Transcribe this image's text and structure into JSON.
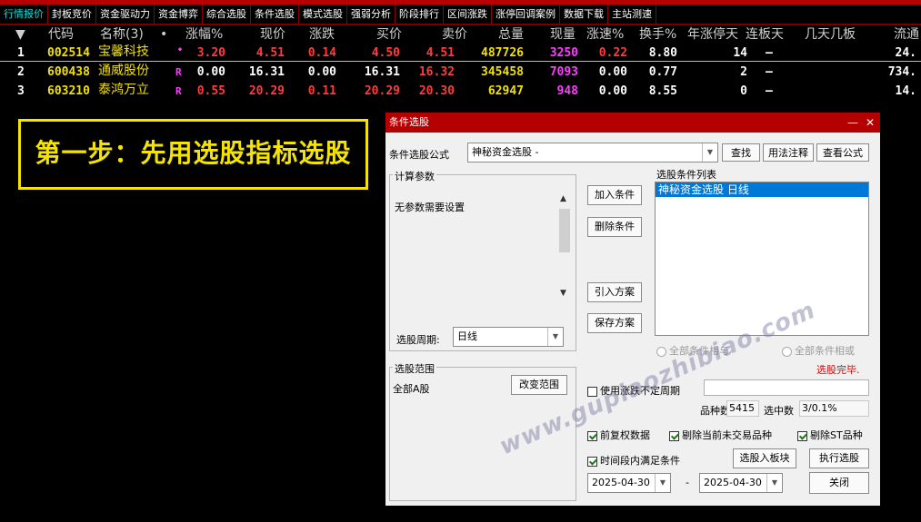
{
  "tabs": [
    "行情报价",
    "封板竞价",
    "资金驱动力",
    "资金博弈",
    "综合选股",
    "条件选股",
    "模式选股",
    "强弱分析",
    "阶段排行",
    "区间涨跌",
    "涨停回调案例",
    "数据下载",
    "主站测速"
  ],
  "headers": {
    "arrow": "▼",
    "code": "代码",
    "name": "名称(3)",
    "dot": "•",
    "pct": "涨幅%",
    "price": "现价",
    "change": "涨跌",
    "bid": "买价",
    "ask": "卖价",
    "volume": "总量",
    "cur_vol": "现量",
    "speed": "涨速%",
    "turnover": "换手%",
    "limit_days": "年涨停天",
    "board_days": "连板天",
    "streak": "几天几板",
    "float": "流通"
  },
  "rows": [
    {
      "idx": "1",
      "code": "002514",
      "name": "宝馨科技",
      "flag": "•",
      "pct": "3.20",
      "price": "4.51",
      "change": "0.14",
      "bid": "4.50",
      "ask": "4.51",
      "volume": "487726",
      "cur_vol": "3250",
      "speed": "0.22",
      "turnover": "8.80",
      "limit_days": "14",
      "board_days": "–",
      "float": "24."
    },
    {
      "idx": "2",
      "code": "600438",
      "name": "通威股份",
      "flag": "R",
      "pct": "0.00",
      "price": "16.31",
      "change": "0.00",
      "bid": "16.31",
      "ask": "16.32",
      "volume": "345458",
      "cur_vol": "7093",
      "speed": "0.00",
      "turnover": "0.77",
      "limit_days": "2",
      "board_days": "–",
      "float": "734."
    },
    {
      "idx": "3",
      "code": "603210",
      "name": "泰鸿万立",
      "flag": "R",
      "pct": "0.55",
      "price": "20.29",
      "change": "0.11",
      "bid": "20.29",
      "ask": "20.30",
      "volume": "62947",
      "cur_vol": "948",
      "speed": "0.00",
      "turnover": "8.55",
      "limit_days": "0",
      "board_days": "–",
      "float": "14."
    }
  ],
  "banner": "第一步：先用选股指标选股",
  "dialog": {
    "title": "条件选股",
    "min": "—",
    "close": "✕",
    "formula_label": "条件选股公式",
    "formula_value": "神秘资金选股 -",
    "find": "查找",
    "usage": "用法注释",
    "view": "查看公式",
    "params_group": "计算参数",
    "no_params": "无参数需要设置",
    "add": "加入条件",
    "delete": "删除条件",
    "import": "引入方案",
    "save": "保存方案",
    "list_label": "选股条件列表",
    "list_item": "神秘资金选股  日线",
    "period_label": "选股周期:",
    "period_value": "日线",
    "all_and": "全部条件相与",
    "all_or": "全部条件相或",
    "range_group": "选股范围",
    "range_value": "全部A股",
    "change_range": "改变范围",
    "done": "选股完毕.",
    "use_period": "使用涨跌不定周期",
    "count_label": "品种数",
    "count_value": "5415",
    "selected_label": "选中数",
    "selected_value": "3/0.1%",
    "fq": "前复权数据",
    "excl_untraded": "剔除当前未交易品种",
    "excl_st": "剔除ST品种",
    "time_cond": "时间段内满足条件",
    "to_block": "选股入板块",
    "execute": "执行选股",
    "date_from": "2025-04-30",
    "dash": "-",
    "date_to": "2025-04-30",
    "close_btn": "关闭"
  },
  "watermark": "www.gupiaozhibiao.com",
  "colors": {
    "accent_red": "#b40000",
    "up": "#ff3c3c",
    "selected_blue": "#0078d7",
    "banner": "#f5e400"
  }
}
